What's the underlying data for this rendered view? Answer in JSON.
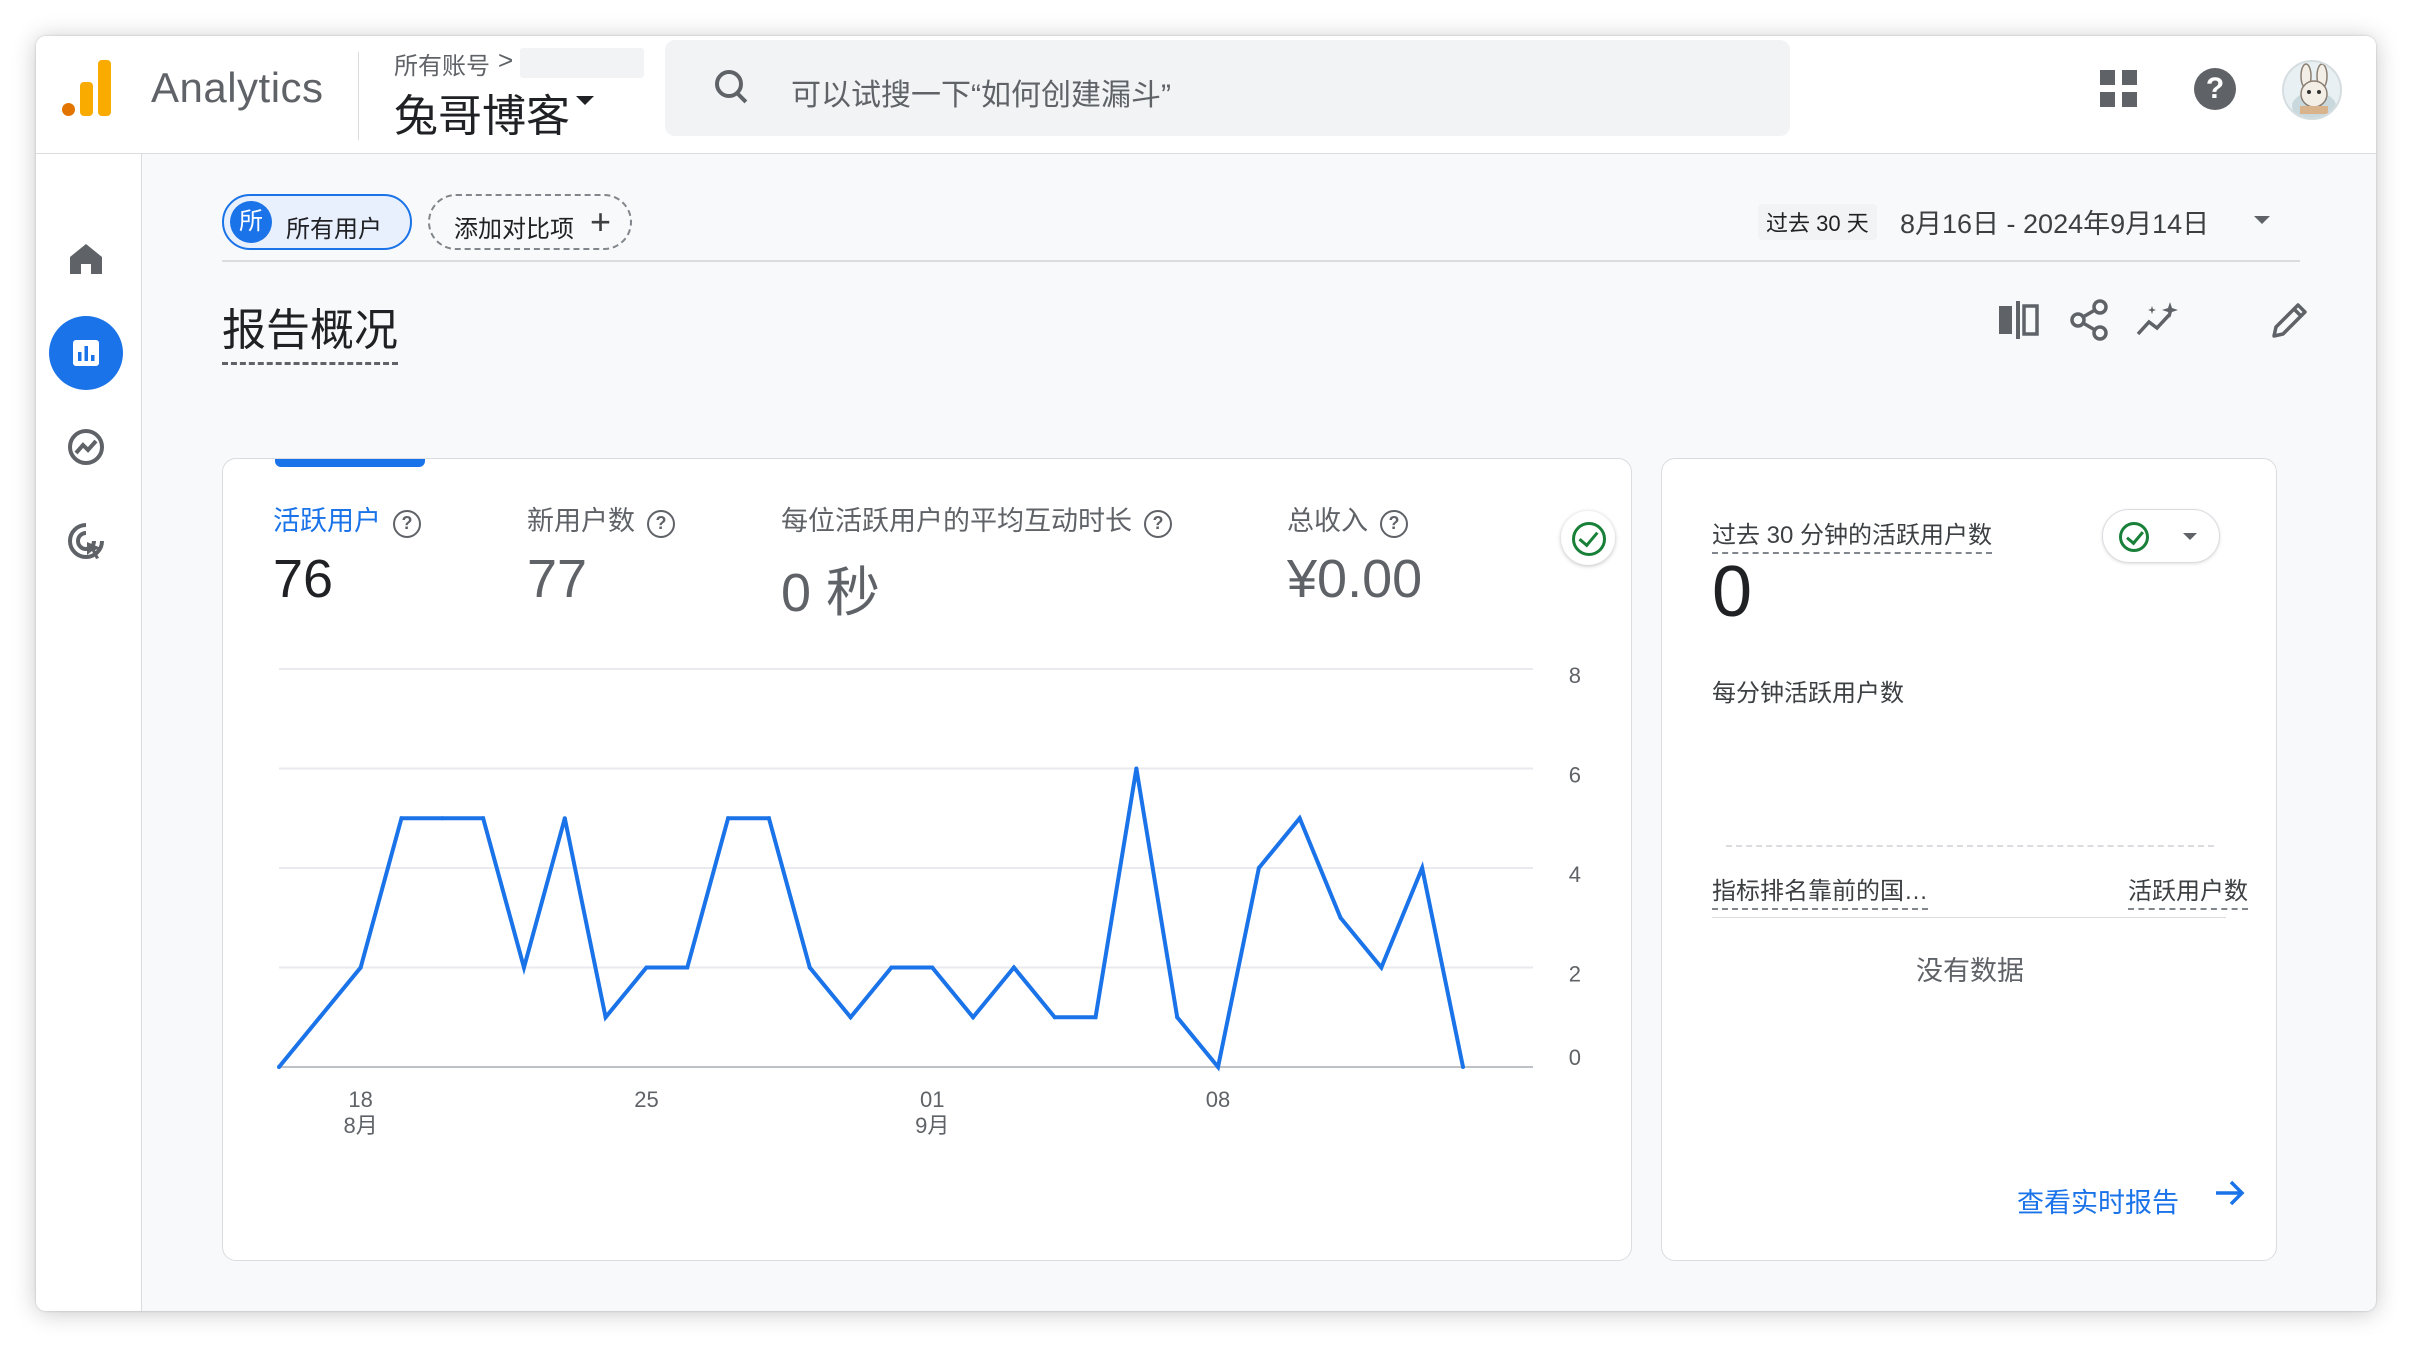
{
  "app": {
    "name": "Analytics"
  },
  "account": {
    "breadcrumb": "所有账号",
    "breadcrumb_separator": ">",
    "name": "兔哥博客"
  },
  "search": {
    "placeholder": "可以试搜一下“如何创建漏斗”"
  },
  "header_icons": [
    "apps-grid-icon",
    "help-icon",
    "avatar"
  ],
  "nav": {
    "items": [
      "home-icon",
      "reports-icon",
      "explore-icon",
      "advertising-icon"
    ],
    "active": "reports-icon"
  },
  "filters": {
    "segment_initial": "所",
    "segment_label": "所有用户",
    "compare_label": "添加对比项",
    "compare_plus": "+"
  },
  "date": {
    "prefix": "过去 30 天",
    "range": "8月16日 - 2024年9月14日"
  },
  "page": {
    "title": "报告概况"
  },
  "toolbar": [
    "compare-icon",
    "share-icon",
    "insights-icon",
    "edit-icon"
  ],
  "metrics": [
    {
      "label": "活跃用户",
      "value": "76",
      "active": true
    },
    {
      "label": "新用户数",
      "value": "77",
      "active": false
    },
    {
      "label": "每位活跃用户的平均互动时长",
      "value": "0 秒",
      "active": false
    },
    {
      "label": "总收入",
      "value": "¥0.00",
      "active": false
    }
  ],
  "metric_help_glyph": "?",
  "chart_data": {
    "type": "line",
    "series": [
      {
        "values": [
          0,
          1,
          2,
          5,
          5,
          5,
          2,
          5,
          1,
          2,
          2,
          5,
          5,
          2,
          1,
          2,
          2,
          1,
          2,
          1,
          1,
          6,
          1,
          0,
          4,
          5,
          3,
          2,
          4,
          0
        ]
      }
    ],
    "x_ticks": [
      {
        "index": 2,
        "day": "18",
        "month": "8月"
      },
      {
        "index": 9,
        "day": "25",
        "month": ""
      },
      {
        "index": 16,
        "day": "01",
        "month": "9月"
      },
      {
        "index": 23,
        "day": "08",
        "month": ""
      }
    ],
    "y_ticks": [
      "0",
      "2",
      "4",
      "6",
      "8"
    ],
    "ylim": [
      0,
      8
    ],
    "grid": true,
    "color": "#1a73e8"
  },
  "realtime": {
    "title": "过去 30 分钟的活跃用户数",
    "value": "0",
    "subtitle": "每分钟活跃用户数",
    "col1": "指标排名靠前的国…",
    "col2": "活跃用户数",
    "empty": "没有数据",
    "link": "查看实时报告"
  },
  "colors": {
    "accent": "#1a73e8",
    "success": "#188038",
    "logo_orange": "#e37400",
    "logo_yellow": "#f9ab00"
  }
}
